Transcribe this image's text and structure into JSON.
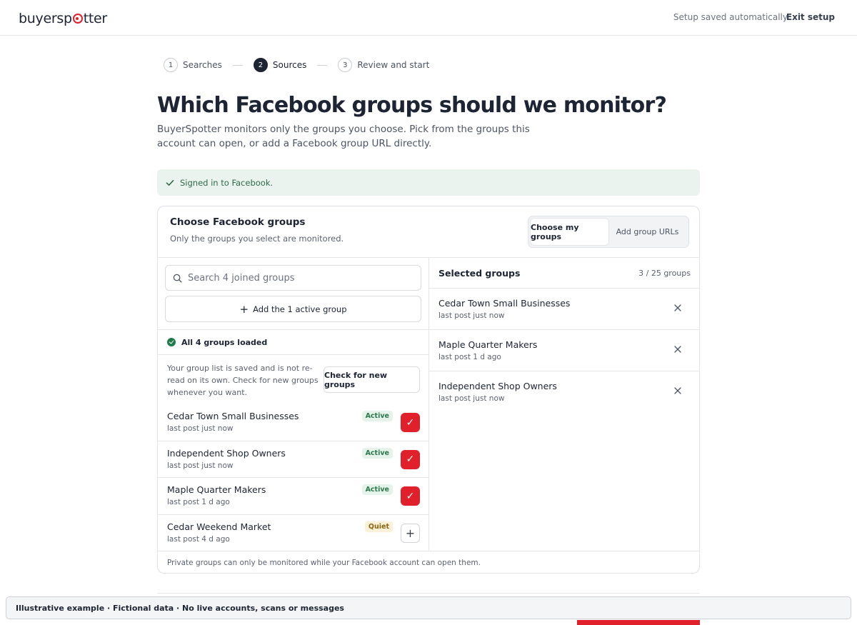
{
  "header": {
    "logo_text_a": "buyersp",
    "logo_text_b": "tter",
    "saved_status": "Setup saved automatically",
    "exit_label": "Exit setup"
  },
  "stepper": {
    "steps": [
      {
        "num": "1",
        "label": "Searches",
        "active": false
      },
      {
        "num": "2",
        "label": "Sources",
        "active": true
      },
      {
        "num": "3",
        "label": "Review and start",
        "active": false
      }
    ]
  },
  "page": {
    "title": "Which Facebook groups should we monitor?",
    "subtitle": "BuyerSpotter monitors only the groups you choose. Pick from the groups this account can open, or add a Facebook group URL directly."
  },
  "alert": {
    "text": "Signed in to Facebook.",
    "color": "#2f6b48"
  },
  "card": {
    "title": "Choose Facebook groups",
    "subtitle": "Only the groups you select are monitored.",
    "segmented": {
      "option_a": "Choose my groups",
      "option_b": "Add group URLs",
      "selected": "Choose my groups"
    },
    "footer": "Private groups can only be monitored while your Facebook account can open them."
  },
  "left": {
    "search_placeholder": "Search 4 joined groups",
    "add_active_label": "Add the 1 active group",
    "loaded_text": "All 4 groups loaded",
    "refresh_note": "Your group list is saved and is not re-read on its own. Check for new groups whenever you want.",
    "check_new_label": "Check for new groups",
    "groups": [
      {
        "name": "Cedar Town Small Businesses",
        "meta": "last post just now",
        "badge": "Active",
        "selected": true,
        "toggle": "✓"
      },
      {
        "name": "Independent Shop Owners",
        "meta": "last post just now",
        "badge": "Active",
        "selected": true,
        "toggle": "✓"
      },
      {
        "name": "Maple Quarter Makers",
        "meta": "last post 1 d ago",
        "badge": "Active",
        "selected": true,
        "toggle": "✓"
      },
      {
        "name": "Cedar Weekend Market",
        "meta": "last post 4 d ago",
        "badge": "Quiet",
        "selected": false,
        "toggle": "+"
      }
    ]
  },
  "right": {
    "title": "Selected groups",
    "count": "3 / 25 groups",
    "selected": [
      {
        "name": "Cedar Town Small Businesses",
        "meta": "last post just now"
      },
      {
        "name": "Maple Quarter Makers",
        "meta": "last post 1 d ago"
      },
      {
        "name": "Independent Shop Owners",
        "meta": "last post just now"
      }
    ]
  },
  "banner": {
    "text": "Illustrative example · Fictional data · No live accounts, scans or messages"
  },
  "colors": {
    "accent": "#e0202a",
    "ink": "#1d2433",
    "success": "#1f7a4a"
  }
}
